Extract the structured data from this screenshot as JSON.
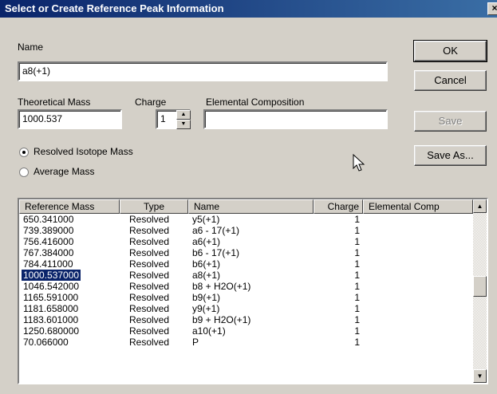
{
  "window": {
    "title": "Select or Create Reference Peak Information",
    "close_label": "×"
  },
  "name_section": {
    "label": "Name",
    "value": "a8(+1)"
  },
  "theoretical_mass": {
    "label": "Theoretical Mass",
    "value": "1000.537"
  },
  "charge": {
    "label": "Charge",
    "value": "1"
  },
  "elemental_composition": {
    "label": "Elemental Composition",
    "value": ""
  },
  "buttons": {
    "ok": "OK",
    "cancel": "Cancel",
    "save": "Save",
    "save_as": "Save As..."
  },
  "mass_type": {
    "resolved_label": "Resolved Isotope Mass",
    "average_label": "Average Mass",
    "selected": "resolved"
  },
  "table": {
    "columns": [
      "Reference Mass",
      "Type",
      "Name",
      "Charge",
      "Elemental Comp"
    ],
    "selected_index": 5,
    "rows": [
      {
        "mass": "650.341000",
        "type": "Resolved",
        "name": "y5(+1)",
        "charge": "1",
        "comp": ""
      },
      {
        "mass": "739.389000",
        "type": "Resolved",
        "name": "a6 - 17(+1)",
        "charge": "1",
        "comp": ""
      },
      {
        "mass": "756.416000",
        "type": "Resolved",
        "name": "a6(+1)",
        "charge": "1",
        "comp": ""
      },
      {
        "mass": "767.384000",
        "type": "Resolved",
        "name": "b6 - 17(+1)",
        "charge": "1",
        "comp": ""
      },
      {
        "mass": "784.411000",
        "type": "Resolved",
        "name": "b6(+1)",
        "charge": "1",
        "comp": ""
      },
      {
        "mass": "1000.537000",
        "type": "Resolved",
        "name": "a8(+1)",
        "charge": "1",
        "comp": ""
      },
      {
        "mass": "1046.542000",
        "type": "Resolved",
        "name": "b8 + H2O(+1)",
        "charge": "1",
        "comp": ""
      },
      {
        "mass": "1165.591000",
        "type": "Resolved",
        "name": "b9(+1)",
        "charge": "1",
        "comp": ""
      },
      {
        "mass": "1181.658000",
        "type": "Resolved",
        "name": "y9(+1)",
        "charge": "1",
        "comp": ""
      },
      {
        "mass": "1183.601000",
        "type": "Resolved",
        "name": "b9 + H2O(+1)",
        "charge": "1",
        "comp": ""
      },
      {
        "mass": "1250.680000",
        "type": "Resolved",
        "name": "a10(+1)",
        "charge": "1",
        "comp": ""
      },
      {
        "mass": "70.066000",
        "type": "Resolved",
        "name": "P",
        "charge": "1",
        "comp": ""
      }
    ]
  }
}
